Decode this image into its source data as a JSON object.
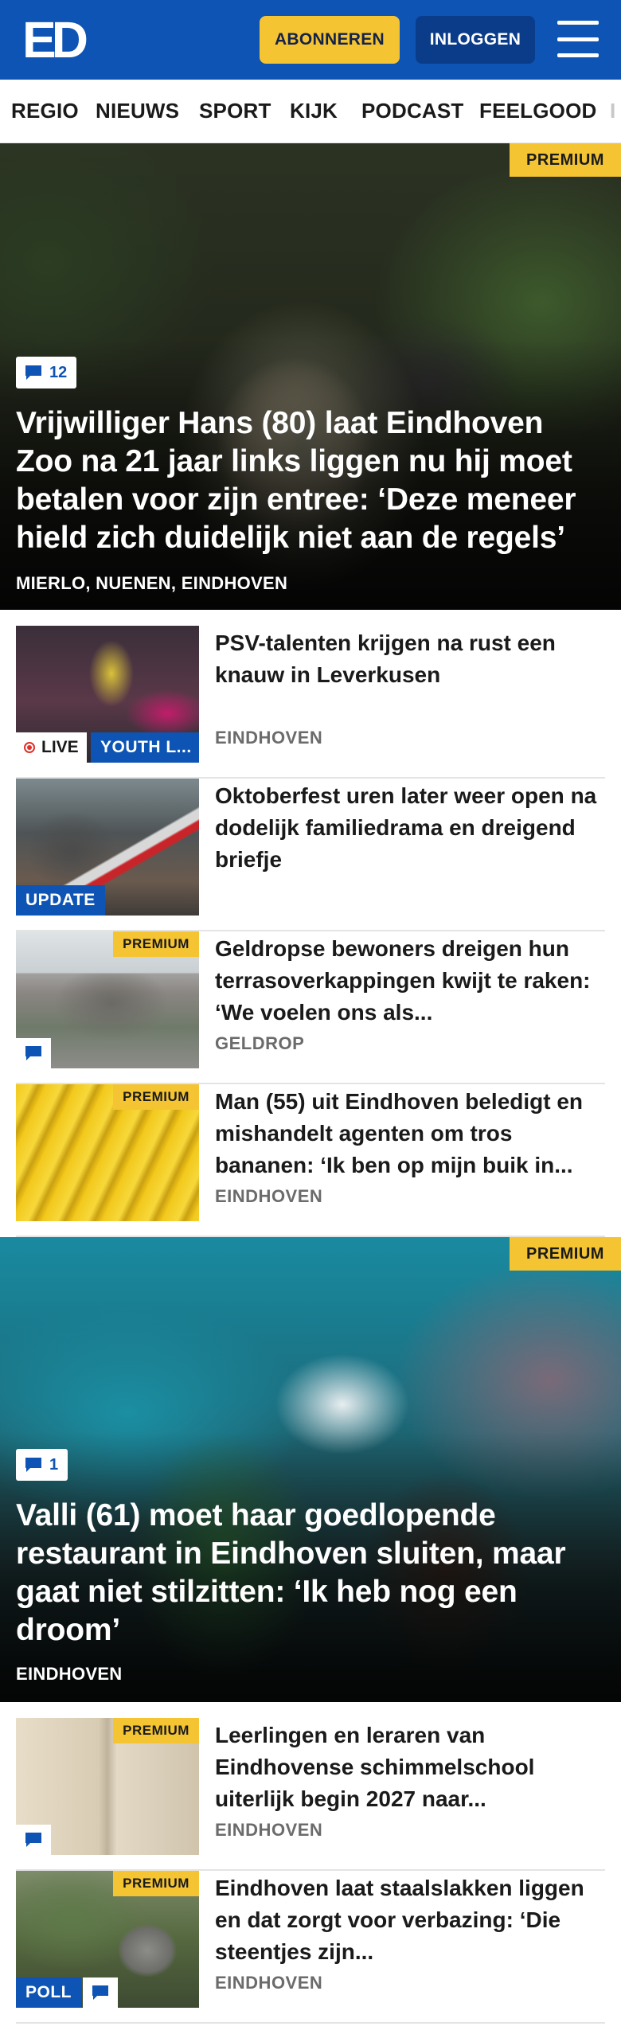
{
  "header": {
    "logo": "ED",
    "subscribe_label": "ABONNEREN",
    "login_label": "INLOGGEN",
    "menu_icon": "hamburger-menu-icon",
    "colors": {
      "brand": "#0d54b4",
      "accent": "#f4c433"
    }
  },
  "nav": {
    "items": [
      "REGIO",
      "NIEUWS",
      "SPORT",
      "KIJK",
      "PODCAST",
      "FEELGOOD",
      "I"
    ]
  },
  "hero1": {
    "badge": "PREMIUM",
    "comments": "12",
    "title": "Vrijwilliger Hans (80) laat Eindhoven Zoo na 21 jaar links liggen nu hij moet betalen voor zijn entree: ‘Deze meneer hield zich duidelijk niet aan de regels’",
    "location": "MIERLO, NUENEN, EINDHOVEN"
  },
  "articles1": [
    {
      "title": "PSV-talenten krijgen na rust een knauw in Leverkusen",
      "location": "EINDHOVEN",
      "live_label": "LIVE",
      "tag": "YOUTH L..."
    },
    {
      "title": "Oktoberfest uren later weer open na dodelijk familiedrama en dreigend briefje",
      "location": "",
      "tag": "UPDATE"
    },
    {
      "title": "Geldropse bewoners dreigen hun terrasoverkappingen kwijt te raken: ‘We voelen ons als...",
      "location": "GELDROP",
      "badge": "PREMIUM"
    },
    {
      "title": "Man (55) uit Eindhoven beledigt en mishandelt agenten om tros bananen: ‘Ik ben op mijn buik in...",
      "location": "EINDHOVEN",
      "badge": "PREMIUM"
    }
  ],
  "hero2": {
    "badge": "PREMIUM",
    "comments": "1",
    "title": "Valli (61) moet haar goedlopende restaurant in Eindhoven sluiten, maar gaat niet stilzitten: ‘Ik heb nog een droom’",
    "location": "EINDHOVEN"
  },
  "articles2": [
    {
      "title": "Leerlingen en leraren van Eindhovense schimmelschool uiterlijk begin 2027 naar...",
      "location": "EINDHOVEN",
      "badge": "PREMIUM"
    },
    {
      "title": "Eindhoven laat staalslakken liggen en dat zorgt voor verbazing: ‘Die steentjes zijn...",
      "location": "EINDHOVEN",
      "badge": "PREMIUM",
      "tag": "POLL"
    }
  ]
}
